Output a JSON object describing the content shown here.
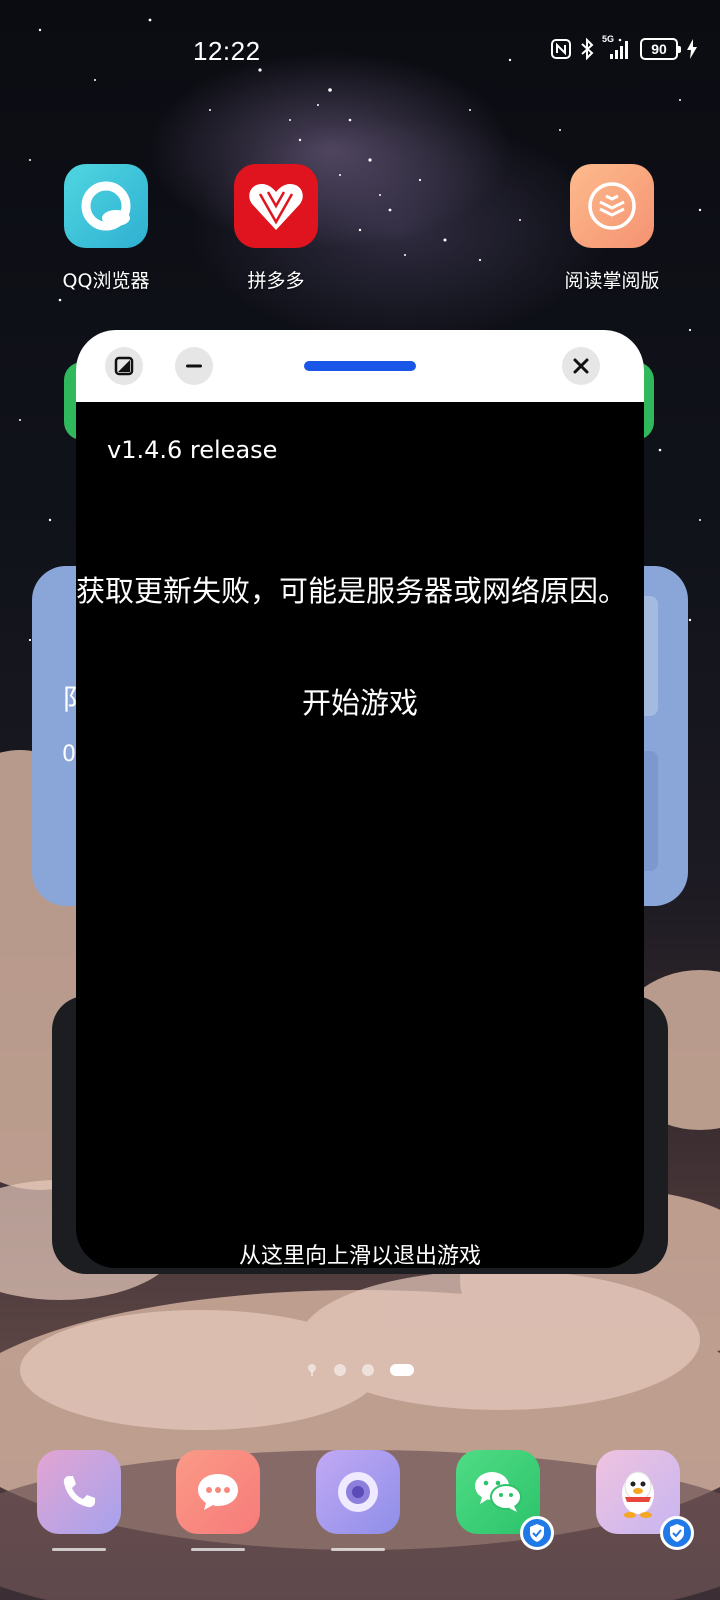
{
  "status_bar": {
    "time": "12:22",
    "signal_label": "5G",
    "battery": "90",
    "icons": [
      "nfc-icon",
      "bluetooth-icon",
      "signal-icon",
      "battery-icon",
      "charging-icon"
    ]
  },
  "home_apps": [
    {
      "label": "QQ浏览器",
      "icon": "qq-browser-icon",
      "color": "#3fc6d8"
    },
    {
      "label": "拼多多",
      "icon": "pinduoduo-icon",
      "color": "#e0141e"
    },
    {
      "label": "阅读掌阅版",
      "icon": "zhangyue-reader-icon",
      "color": "#f8a07a"
    }
  ],
  "widgets": {
    "blue_widget_fragments": [
      "阝",
      "0"
    ]
  },
  "game_window": {
    "titlebar_buttons": [
      "fullscreen-icon",
      "minimize-icon",
      "close-icon"
    ],
    "accent_color": "#1a56e8",
    "version": "v1.4.6 release",
    "error_message": "获取更新失败，可能是服务器或网络原因。",
    "start_button": "开始游戏",
    "swipe_hint": "从这里向上滑以退出游戏"
  },
  "page_indicator": {
    "total": 4,
    "active_index": 3
  },
  "dock": [
    {
      "name": "phone",
      "icon": "phone-icon",
      "color": "#b9a6e6"
    },
    {
      "name": "messages",
      "icon": "message-icon",
      "color": "#f7887a"
    },
    {
      "name": "camera",
      "icon": "camera-icon",
      "color": "#a89cf0"
    },
    {
      "name": "wechat",
      "icon": "wechat-icon",
      "color": "#37d07a"
    },
    {
      "name": "qq",
      "icon": "qq-penguin-icon",
      "color": "#d9b9ea"
    }
  ]
}
